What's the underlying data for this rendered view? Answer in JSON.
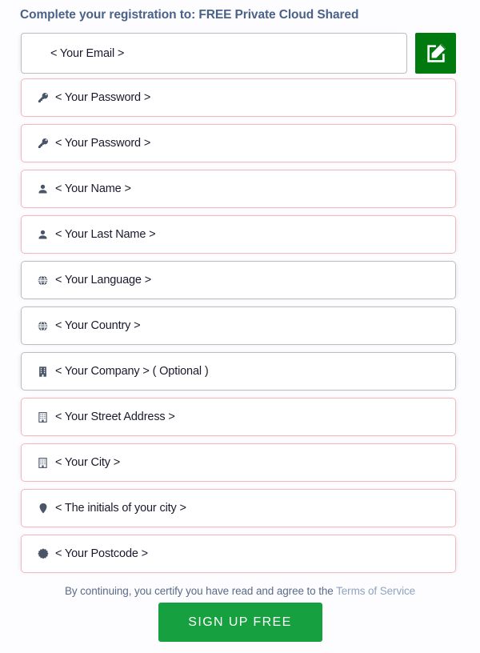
{
  "header": {
    "lead_text": "Complete your registration to:",
    "emphasis_text": "FREE Private Cloud Shared",
    "color": "#4a6287"
  },
  "email": {
    "placeholder": "< Your Email >",
    "border_color": "#bdbdbd",
    "edit_button": {
      "icon": "edit-square-icon",
      "background_color": "#007a0f"
    }
  },
  "fields": [
    {
      "name": "password",
      "icon": "key-icon",
      "placeholder": "< Your Password >",
      "border_color": "#f1b9bd"
    },
    {
      "name": "password-confirm",
      "icon": "key-icon",
      "placeholder": "< Your Password >",
      "border_color": "#f1b9bd"
    },
    {
      "name": "first-name",
      "icon": "user-icon",
      "placeholder": "< Your Name >",
      "border_color": "#f1b9bd"
    },
    {
      "name": "last-name",
      "icon": "user-icon",
      "placeholder": "< Your Last Name >",
      "border_color": "#f1b9bd"
    },
    {
      "name": "language",
      "icon": "globe-icon",
      "placeholder": "< Your Language >",
      "border_color": "#bdbdbd"
    },
    {
      "name": "country",
      "icon": "globe-icon",
      "placeholder": "< Your Country >",
      "border_color": "#bdbdbd"
    },
    {
      "name": "company",
      "icon": "building-solid-icon",
      "placeholder": "< Your Company > ( Optional )",
      "border_color": "#bdbdbd"
    },
    {
      "name": "street-address",
      "icon": "building-icon",
      "placeholder": "< Your Street Address >",
      "border_color": "#f1b9bd"
    },
    {
      "name": "city",
      "icon": "building-icon",
      "placeholder": "< Your City >",
      "border_color": "#f1b9bd"
    },
    {
      "name": "city-initials",
      "icon": "map-marker-icon",
      "placeholder": "< The initials of your city >",
      "border_color": "#f1b9bd"
    },
    {
      "name": "postcode",
      "icon": "certificate-icon",
      "placeholder": "< Your Postcode >",
      "border_color": "#f1b9bd"
    }
  ],
  "footer": {
    "terms_text": "By continuing, you certify you have read and agree to the ",
    "terms_link_label": "Terms of Service",
    "terms_link_color": "#8fa3bf",
    "submit_label": "SIGN UP FREE",
    "submit_color": "#16a03f"
  }
}
